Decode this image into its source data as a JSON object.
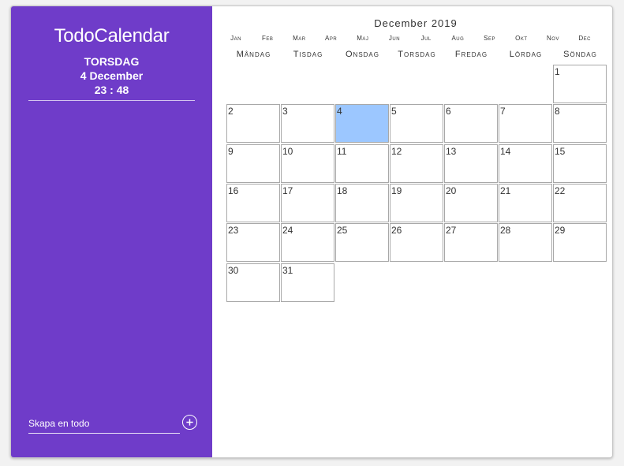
{
  "sidebar": {
    "brand": "TodoCalendar",
    "weekday": "TORSDAG",
    "date": "4 December",
    "time": "23 : 48",
    "todo_placeholder": "Skapa en todo"
  },
  "calendar": {
    "month_title": "December 2019",
    "months": [
      "Jan",
      "Feb",
      "Mar",
      "Apr",
      "Maj",
      "Jun",
      "Jul",
      "Aug",
      "Sep",
      "Okt",
      "Nov",
      "Dec"
    ],
    "weekdays": [
      "Måndag",
      "Tisdag",
      "Onsdag",
      "Torsdag",
      "Fredag",
      "Lördag",
      "Söndag"
    ],
    "first_weekday_index": 6,
    "days_in_month": 31,
    "today": 4
  },
  "colors": {
    "sidebar_bg": "#6f3cc9",
    "today_bg": "#9cc7ff",
    "cell_border": "#a8a8a8"
  }
}
